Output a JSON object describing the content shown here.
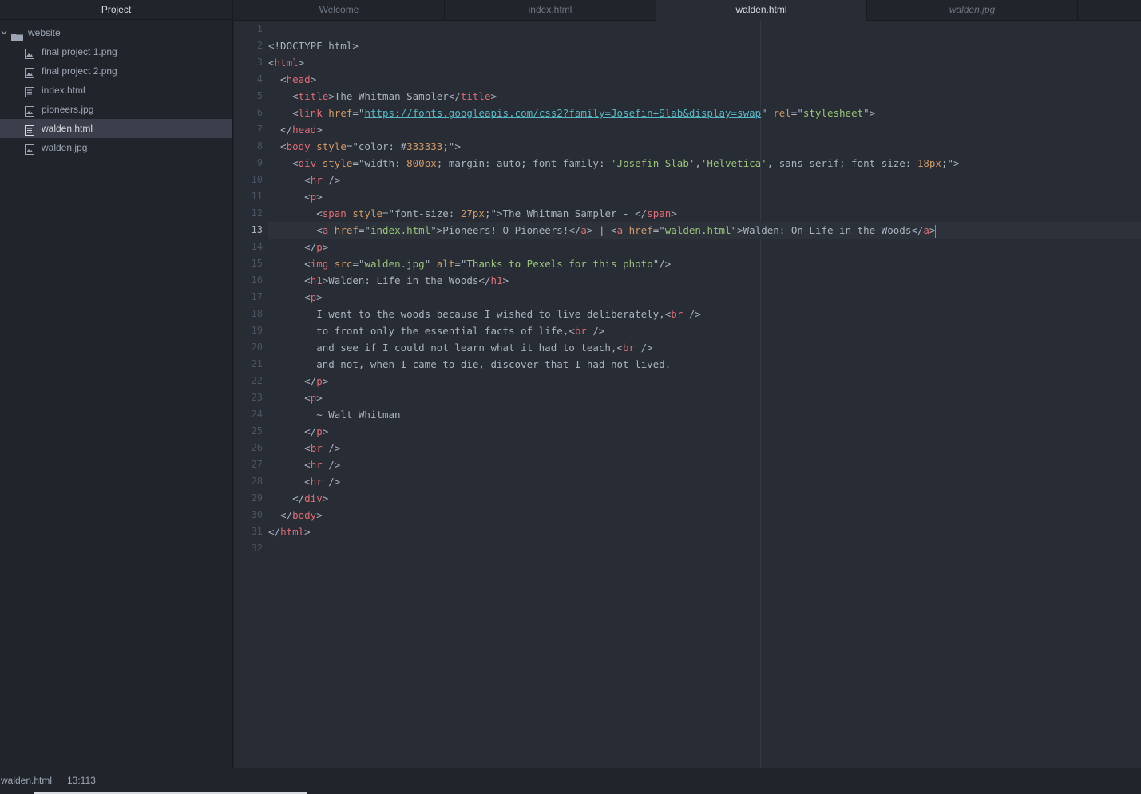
{
  "sidebar": {
    "title": "Project",
    "folder": {
      "name": "website",
      "icon": "folder-icon"
    },
    "files": [
      {
        "name": "final project 1.png",
        "icon": "image-file-icon"
      },
      {
        "name": "final project 2.png",
        "icon": "image-file-icon"
      },
      {
        "name": "index.html",
        "icon": "text-file-icon"
      },
      {
        "name": "pioneers.jpg",
        "icon": "image-file-icon"
      },
      {
        "name": "walden.html",
        "icon": "text-file-icon",
        "selected": true
      },
      {
        "name": "walden.jpg",
        "icon": "image-file-icon"
      }
    ]
  },
  "tabs": [
    {
      "label": "Welcome"
    },
    {
      "label": "index.html"
    },
    {
      "label": "walden.html",
      "active": true
    },
    {
      "label": "walden.jpg",
      "preview": true
    }
  ],
  "editor": {
    "current_line": 13,
    "line_numbers": [
      "1",
      "2",
      "3",
      "4",
      "5",
      "6",
      "7",
      "8",
      "9",
      "10",
      "11",
      "12",
      "13",
      "14",
      "15",
      "16",
      "17",
      "18",
      "19",
      "20",
      "21",
      "22",
      "23",
      "24",
      "25",
      "26",
      "27",
      "28",
      "29",
      "30",
      "31",
      "32"
    ],
    "lines": [
      [],
      [
        [
          "p",
          "<!DOCTYPE html>"
        ]
      ],
      [
        [
          "p",
          "<"
        ],
        [
          "t",
          "html"
        ],
        [
          "p",
          ">"
        ]
      ],
      [
        [
          "p",
          "  <"
        ],
        [
          "t",
          "head"
        ],
        [
          "p",
          ">"
        ]
      ],
      [
        [
          "p",
          "    <"
        ],
        [
          "t",
          "title"
        ],
        [
          "p",
          ">The Whitman Sampler</"
        ],
        [
          "t",
          "title"
        ],
        [
          "p",
          ">"
        ]
      ],
      [
        [
          "p",
          "    <"
        ],
        [
          "t",
          "link"
        ],
        [
          "p",
          " "
        ],
        [
          "a",
          "href"
        ],
        [
          "p",
          "=\""
        ],
        [
          "u",
          "https://fonts.googleapis.com/css2?family=Josefin+Slab&display=swap"
        ],
        [
          "p",
          "\" "
        ],
        [
          "a",
          "rel"
        ],
        [
          "p",
          "=\""
        ],
        [
          "s",
          "stylesheet"
        ],
        [
          "p",
          "\">"
        ]
      ],
      [
        [
          "p",
          "  </"
        ],
        [
          "t",
          "head"
        ],
        [
          "p",
          ">"
        ]
      ],
      [
        [
          "p",
          "  <"
        ],
        [
          "t",
          "body"
        ],
        [
          "p",
          " "
        ],
        [
          "a",
          "style"
        ],
        [
          "p",
          "=\"color: #"
        ],
        [
          "n",
          "333333"
        ],
        [
          "p",
          ";\">"
        ]
      ],
      [
        [
          "p",
          "    <"
        ],
        [
          "t",
          "div"
        ],
        [
          "p",
          " "
        ],
        [
          "a",
          "style"
        ],
        [
          "p",
          "=\"width: "
        ],
        [
          "n",
          "800px"
        ],
        [
          "p",
          "; margin: auto; font-family: "
        ],
        [
          "s",
          "'Josefin Slab'"
        ],
        [
          "p",
          ","
        ],
        [
          "s",
          "'Helvetica'"
        ],
        [
          "p",
          ", sans-serif; font-size: "
        ],
        [
          "n",
          "18px"
        ],
        [
          "p",
          ";\">"
        ]
      ],
      [
        [
          "p",
          "      <"
        ],
        [
          "t",
          "hr"
        ],
        [
          "p",
          " />"
        ]
      ],
      [
        [
          "p",
          "      <"
        ],
        [
          "t",
          "p"
        ],
        [
          "p",
          ">"
        ]
      ],
      [
        [
          "p",
          "        <"
        ],
        [
          "t",
          "span"
        ],
        [
          "p",
          " "
        ],
        [
          "a",
          "style"
        ],
        [
          "p",
          "=\"font-size: "
        ],
        [
          "n",
          "27px"
        ],
        [
          "p",
          ";\">The Whitman Sampler - </"
        ],
        [
          "t",
          "span"
        ],
        [
          "p",
          ">"
        ]
      ],
      [
        [
          "p",
          "        <"
        ],
        [
          "t",
          "a"
        ],
        [
          "p",
          " "
        ],
        [
          "a",
          "href"
        ],
        [
          "p",
          "=\""
        ],
        [
          "s",
          "index.html"
        ],
        [
          "p",
          "\">Pioneers! O Pioneers!</"
        ],
        [
          "t",
          "a"
        ],
        [
          "p",
          "> | <"
        ],
        [
          "t",
          "a"
        ],
        [
          "p",
          " "
        ],
        [
          "a",
          "href"
        ],
        [
          "p",
          "=\""
        ],
        [
          "s",
          "walden.html"
        ],
        [
          "p",
          "\">Walden: On Life in the Woods</"
        ],
        [
          "t",
          "a"
        ],
        [
          "p",
          ">"
        ]
      ],
      [
        [
          "p",
          "      </"
        ],
        [
          "t",
          "p"
        ],
        [
          "p",
          ">"
        ]
      ],
      [
        [
          "p",
          "      <"
        ],
        [
          "t",
          "img"
        ],
        [
          "p",
          " "
        ],
        [
          "a",
          "src"
        ],
        [
          "p",
          "=\""
        ],
        [
          "s",
          "walden.jpg"
        ],
        [
          "p",
          "\" "
        ],
        [
          "a",
          "alt"
        ],
        [
          "p",
          "=\""
        ],
        [
          "s",
          "Thanks to Pexels for this photo"
        ],
        [
          "p",
          "\"/>"
        ]
      ],
      [
        [
          "p",
          "      <"
        ],
        [
          "t",
          "h1"
        ],
        [
          "p",
          ">Walden: Life in the Woods</"
        ],
        [
          "t",
          "h1"
        ],
        [
          "p",
          ">"
        ]
      ],
      [
        [
          "p",
          "      <"
        ],
        [
          "t",
          "p"
        ],
        [
          "p",
          ">"
        ]
      ],
      [
        [
          "p",
          "        I went to the woods because I wished to live deliberately,<"
        ],
        [
          "t",
          "br"
        ],
        [
          "p",
          " />"
        ]
      ],
      [
        [
          "p",
          "        to front only the essential facts of life,<"
        ],
        [
          "t",
          "br"
        ],
        [
          "p",
          " />"
        ]
      ],
      [
        [
          "p",
          "        and see if I could not learn what it had to teach,<"
        ],
        [
          "t",
          "br"
        ],
        [
          "p",
          " />"
        ]
      ],
      [
        [
          "p",
          "        and not, when I came to die, discover that I had not lived."
        ]
      ],
      [
        [
          "p",
          "      </"
        ],
        [
          "t",
          "p"
        ],
        [
          "p",
          ">"
        ]
      ],
      [
        [
          "p",
          "      <"
        ],
        [
          "t",
          "p"
        ],
        [
          "p",
          ">"
        ]
      ],
      [
        [
          "p",
          "        ~ Walt Whitman"
        ]
      ],
      [
        [
          "p",
          "      </"
        ],
        [
          "t",
          "p"
        ],
        [
          "p",
          ">"
        ]
      ],
      [
        [
          "p",
          "      <"
        ],
        [
          "t",
          "br"
        ],
        [
          "p",
          " />"
        ]
      ],
      [
        [
          "p",
          "      <"
        ],
        [
          "t",
          "hr"
        ],
        [
          "p",
          " />"
        ]
      ],
      [
        [
          "p",
          "      <"
        ],
        [
          "t",
          "hr"
        ],
        [
          "p",
          " />"
        ]
      ],
      [
        [
          "p",
          "    </"
        ],
        [
          "t",
          "div"
        ],
        [
          "p",
          ">"
        ]
      ],
      [
        [
          "p",
          "  </"
        ],
        [
          "t",
          "body"
        ],
        [
          "p",
          ">"
        ]
      ],
      [
        [
          "p",
          "</"
        ],
        [
          "t",
          "html"
        ],
        [
          "p",
          ">"
        ]
      ],
      []
    ]
  },
  "statusbar": {
    "file": "walden.html",
    "cursor_position": "13:113"
  },
  "colors": {
    "tag": "#e06c75",
    "attribute": "#d19a66",
    "string": "#98c379",
    "url": "#56b6c2",
    "number": "#d19a66",
    "plain": "#abb2bf",
    "editor_background": "#282c34",
    "panel_background": "#21252b"
  }
}
